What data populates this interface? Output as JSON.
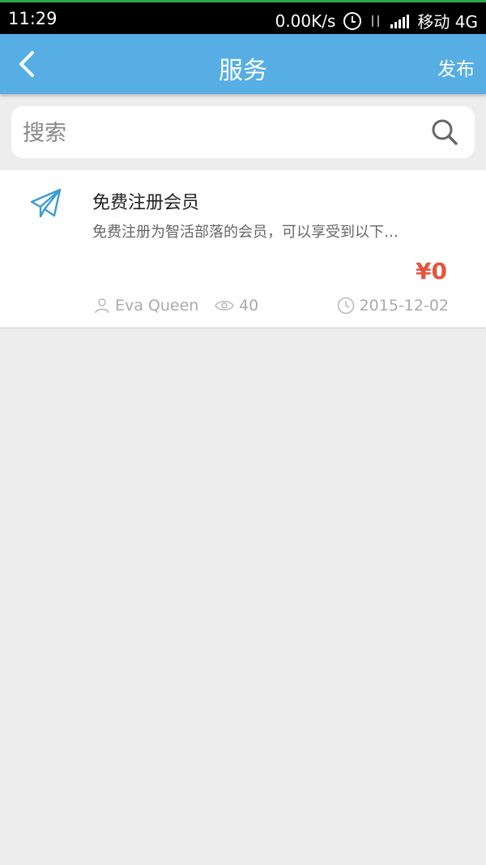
{
  "status_bar": {
    "time": "11:29",
    "speed": "0.00K/s",
    "carrier": "移动 4G"
  },
  "header": {
    "title": "服务",
    "publish_label": "发布"
  },
  "search": {
    "placeholder": "搜索"
  },
  "items": [
    {
      "title": "免费注册会员",
      "description": "免费注册为智活部落的会员，可以享受到以下…",
      "price": "¥0",
      "author": "Eva Queen",
      "views": "40",
      "date": "2015-12-02",
      "icon": "paper-plane-icon"
    }
  ],
  "colors": {
    "header_bg": "#56aee4",
    "price": "#e5533b",
    "page_bg": "#ededed"
  }
}
